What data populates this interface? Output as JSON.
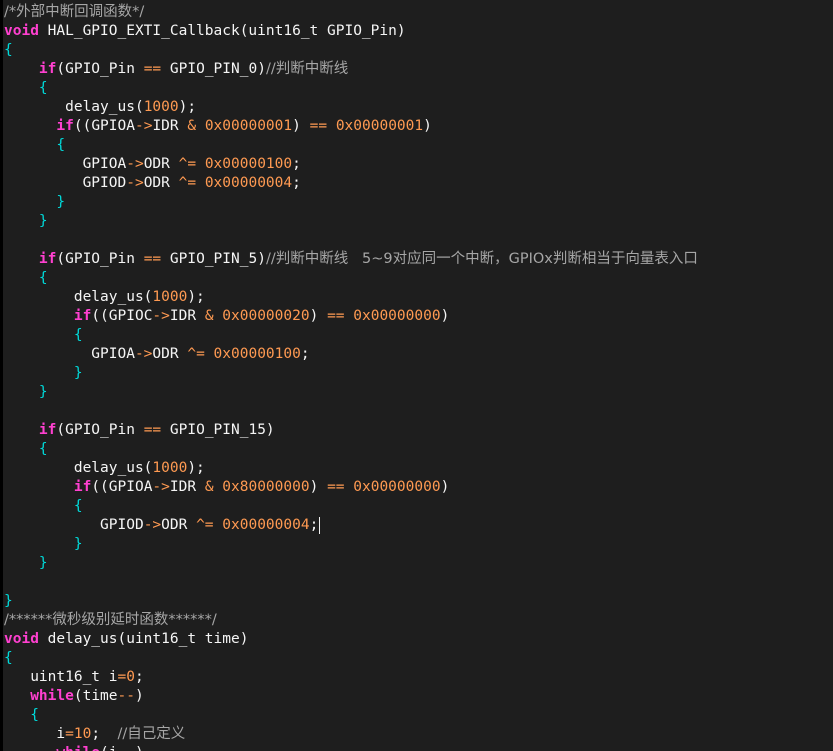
{
  "editor": {
    "colors": {
      "background": "#1e1e1e",
      "keyword": "#ff40d0",
      "number": "#ff9a52",
      "brace": "#00d9d9",
      "comment": "#a6a6a6",
      "text": "#f5f5f5"
    },
    "lines": [
      [
        {
          "t": "comment",
          "v": "/*外部中断回调函数*/"
        }
      ],
      [
        {
          "t": "keyword",
          "v": "void"
        },
        {
          "t": "plain",
          "v": " HAL_GPIO_EXTI_Callback(uint16_t GPIO_Pin)"
        }
      ],
      [
        {
          "t": "brace",
          "v": "{"
        }
      ],
      [
        {
          "t": "plain",
          "v": "    "
        },
        {
          "t": "keyword",
          "v": "if"
        },
        {
          "t": "plain",
          "v": "(GPIO_Pin "
        },
        {
          "t": "op",
          "v": "=="
        },
        {
          "t": "plain",
          "v": " GPIO_PIN_0)"
        },
        {
          "t": "comment",
          "v": "//判断中断线"
        }
      ],
      [
        {
          "t": "plain",
          "v": "    "
        },
        {
          "t": "brace",
          "v": "{"
        }
      ],
      [
        {
          "t": "plain",
          "v": "       delay_us("
        },
        {
          "t": "number",
          "v": "1000"
        },
        {
          "t": "plain",
          "v": ");"
        }
      ],
      [
        {
          "t": "plain",
          "v": "      "
        },
        {
          "t": "keyword",
          "v": "if"
        },
        {
          "t": "plain",
          "v": "((GPIOA"
        },
        {
          "t": "op",
          "v": "->"
        },
        {
          "t": "plain",
          "v": "IDR "
        },
        {
          "t": "op",
          "v": "&"
        },
        {
          "t": "plain",
          "v": " "
        },
        {
          "t": "number",
          "v": "0x00000001"
        },
        {
          "t": "plain",
          "v": ") "
        },
        {
          "t": "op",
          "v": "=="
        },
        {
          "t": "plain",
          "v": " "
        },
        {
          "t": "number",
          "v": "0x00000001"
        },
        {
          "t": "plain",
          "v": ")"
        }
      ],
      [
        {
          "t": "plain",
          "v": "      "
        },
        {
          "t": "brace",
          "v": "{"
        }
      ],
      [
        {
          "t": "plain",
          "v": "         GPIOA"
        },
        {
          "t": "op",
          "v": "->"
        },
        {
          "t": "plain",
          "v": "ODR "
        },
        {
          "t": "op",
          "v": "^="
        },
        {
          "t": "plain",
          "v": " "
        },
        {
          "t": "number",
          "v": "0x00000100"
        },
        {
          "t": "plain",
          "v": ";"
        }
      ],
      [
        {
          "t": "plain",
          "v": "         GPIOD"
        },
        {
          "t": "op",
          "v": "->"
        },
        {
          "t": "plain",
          "v": "ODR "
        },
        {
          "t": "op",
          "v": "^="
        },
        {
          "t": "plain",
          "v": " "
        },
        {
          "t": "number",
          "v": "0x00000004"
        },
        {
          "t": "plain",
          "v": ";"
        }
      ],
      [
        {
          "t": "plain",
          "v": "      "
        },
        {
          "t": "brace",
          "v": "}"
        }
      ],
      [
        {
          "t": "plain",
          "v": "    "
        },
        {
          "t": "brace",
          "v": "}"
        }
      ],
      [
        {
          "t": "plain",
          "v": ""
        }
      ],
      [
        {
          "t": "plain",
          "v": "    "
        },
        {
          "t": "keyword",
          "v": "if"
        },
        {
          "t": "plain",
          "v": "(GPIO_Pin "
        },
        {
          "t": "op",
          "v": "=="
        },
        {
          "t": "plain",
          "v": " GPIO_PIN_5)"
        },
        {
          "t": "comment",
          "v": "//判断中断线   5~9对应同一个中断，GPIOx判断相当于向量表入口"
        }
      ],
      [
        {
          "t": "plain",
          "v": "    "
        },
        {
          "t": "brace",
          "v": "{"
        }
      ],
      [
        {
          "t": "plain",
          "v": "        delay_us("
        },
        {
          "t": "number",
          "v": "1000"
        },
        {
          "t": "plain",
          "v": ");"
        }
      ],
      [
        {
          "t": "plain",
          "v": "        "
        },
        {
          "t": "keyword",
          "v": "if"
        },
        {
          "t": "plain",
          "v": "((GPIOC"
        },
        {
          "t": "op",
          "v": "->"
        },
        {
          "t": "plain",
          "v": "IDR "
        },
        {
          "t": "op",
          "v": "&"
        },
        {
          "t": "plain",
          "v": " "
        },
        {
          "t": "number",
          "v": "0x00000020"
        },
        {
          "t": "plain",
          "v": ") "
        },
        {
          "t": "op",
          "v": "=="
        },
        {
          "t": "plain",
          "v": " "
        },
        {
          "t": "number",
          "v": "0x00000000"
        },
        {
          "t": "plain",
          "v": ")"
        }
      ],
      [
        {
          "t": "plain",
          "v": "        "
        },
        {
          "t": "brace",
          "v": "{"
        }
      ],
      [
        {
          "t": "plain",
          "v": "          GPIOA"
        },
        {
          "t": "op",
          "v": "->"
        },
        {
          "t": "plain",
          "v": "ODR "
        },
        {
          "t": "op",
          "v": "^="
        },
        {
          "t": "plain",
          "v": " "
        },
        {
          "t": "number",
          "v": "0x00000100"
        },
        {
          "t": "plain",
          "v": ";"
        }
      ],
      [
        {
          "t": "plain",
          "v": "        "
        },
        {
          "t": "brace",
          "v": "}"
        }
      ],
      [
        {
          "t": "plain",
          "v": "    "
        },
        {
          "t": "brace",
          "v": "}"
        }
      ],
      [
        {
          "t": "plain",
          "v": ""
        }
      ],
      [
        {
          "t": "plain",
          "v": "    "
        },
        {
          "t": "keyword",
          "v": "if"
        },
        {
          "t": "plain",
          "v": "(GPIO_Pin "
        },
        {
          "t": "op",
          "v": "=="
        },
        {
          "t": "plain",
          "v": " GPIO_PIN_15)"
        }
      ],
      [
        {
          "t": "plain",
          "v": "    "
        },
        {
          "t": "brace",
          "v": "{"
        }
      ],
      [
        {
          "t": "plain",
          "v": "        delay_us("
        },
        {
          "t": "number",
          "v": "1000"
        },
        {
          "t": "plain",
          "v": ");"
        }
      ],
      [
        {
          "t": "plain",
          "v": "        "
        },
        {
          "t": "keyword",
          "v": "if"
        },
        {
          "t": "plain",
          "v": "((GPIOA"
        },
        {
          "t": "op",
          "v": "->"
        },
        {
          "t": "plain",
          "v": "IDR "
        },
        {
          "t": "op",
          "v": "&"
        },
        {
          "t": "plain",
          "v": " "
        },
        {
          "t": "number",
          "v": "0x80000000"
        },
        {
          "t": "plain",
          "v": ") "
        },
        {
          "t": "op",
          "v": "=="
        },
        {
          "t": "plain",
          "v": " "
        },
        {
          "t": "number",
          "v": "0x00000000"
        },
        {
          "t": "plain",
          "v": ")"
        }
      ],
      [
        {
          "t": "plain",
          "v": "        "
        },
        {
          "t": "brace",
          "v": "{"
        }
      ],
      [
        {
          "t": "plain",
          "v": "           GPIOD"
        },
        {
          "t": "op",
          "v": "->"
        },
        {
          "t": "plain",
          "v": "ODR "
        },
        {
          "t": "op",
          "v": "^="
        },
        {
          "t": "plain",
          "v": " "
        },
        {
          "t": "number",
          "v": "0x00000004"
        },
        {
          "t": "plain",
          "v": ";"
        },
        {
          "t": "caret",
          "v": ""
        }
      ],
      [
        {
          "t": "plain",
          "v": "        "
        },
        {
          "t": "brace",
          "v": "}"
        }
      ],
      [
        {
          "t": "plain",
          "v": "    "
        },
        {
          "t": "brace",
          "v": "}"
        }
      ],
      [
        {
          "t": "plain",
          "v": ""
        }
      ],
      [
        {
          "t": "brace",
          "v": "}"
        }
      ],
      [
        {
          "t": "comment",
          "v": "/******微秒级别延时函数******/"
        }
      ],
      [
        {
          "t": "keyword",
          "v": "void"
        },
        {
          "t": "plain",
          "v": " delay_us(uint16_t time)"
        }
      ],
      [
        {
          "t": "brace",
          "v": "{"
        }
      ],
      [
        {
          "t": "plain",
          "v": "   uint16_t i"
        },
        {
          "t": "op",
          "v": "="
        },
        {
          "t": "number",
          "v": "0"
        },
        {
          "t": "plain",
          "v": ";"
        }
      ],
      [
        {
          "t": "plain",
          "v": "   "
        },
        {
          "t": "keyword",
          "v": "while"
        },
        {
          "t": "plain",
          "v": "(time"
        },
        {
          "t": "op",
          "v": "--"
        },
        {
          "t": "plain",
          "v": ")"
        }
      ],
      [
        {
          "t": "plain",
          "v": "   "
        },
        {
          "t": "brace",
          "v": "{"
        }
      ],
      [
        {
          "t": "plain",
          "v": "      i"
        },
        {
          "t": "op",
          "v": "="
        },
        {
          "t": "number",
          "v": "10"
        },
        {
          "t": "plain",
          "v": ";  "
        },
        {
          "t": "comment",
          "v": "//自己定义"
        }
      ],
      [
        {
          "t": "plain",
          "v": "      "
        },
        {
          "t": "keyword",
          "v": "while"
        },
        {
          "t": "plain",
          "v": "(i"
        },
        {
          "t": "op",
          "v": "--"
        },
        {
          "t": "plain",
          "v": ")"
        }
      ]
    ]
  }
}
